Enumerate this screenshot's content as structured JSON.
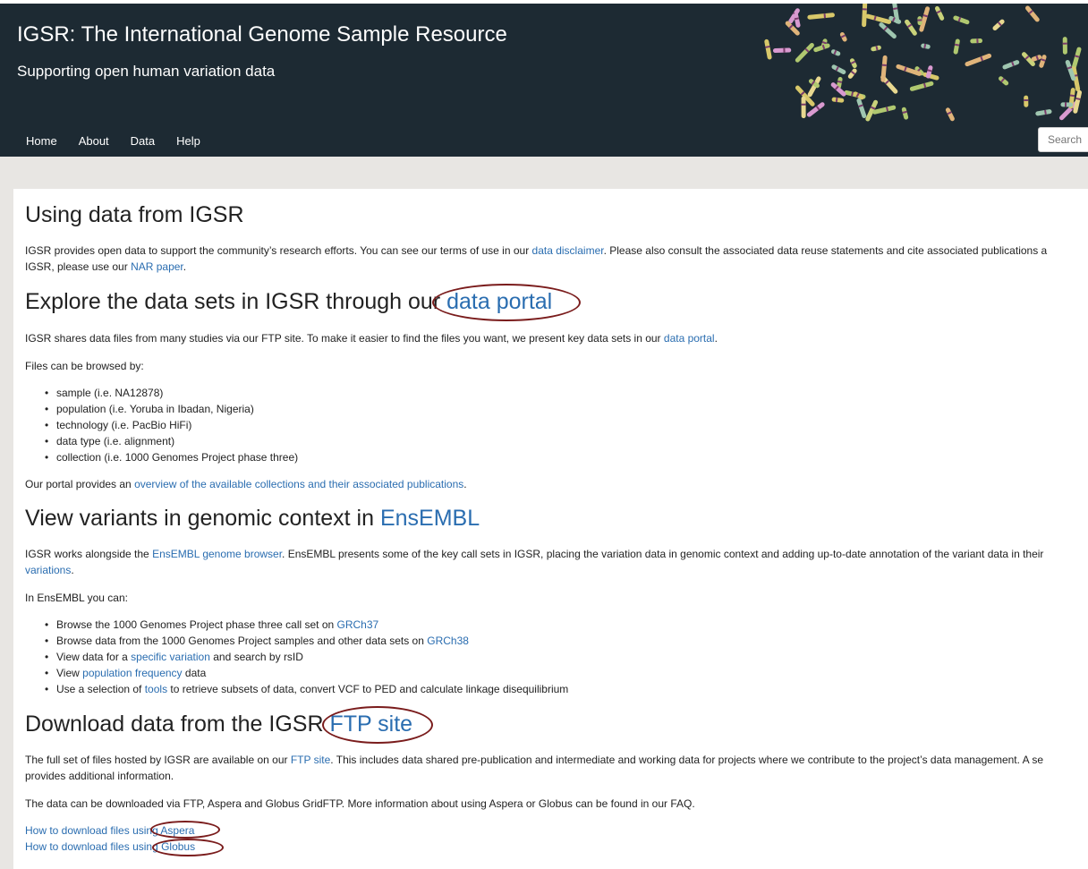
{
  "header": {
    "title": "IGSR: The International Genome Sample Resource",
    "subtitle": "Supporting open human variation data"
  },
  "nav": {
    "items": [
      "Home",
      "About",
      "Data",
      "Help"
    ],
    "search_placeholder": "Search"
  },
  "section_using": {
    "heading": "Using data from IGSR",
    "p1_a": "IGSR provides open data to support the community’s research efforts. You can see our terms of use in our ",
    "p1_link1": "data disclaimer",
    "p1_b": ". Please also consult the associated data reuse statements and cite associated publications a",
    "p1_line2_a": "IGSR, please use our ",
    "p1_link2": "NAR paper",
    "p1_line2_b": "."
  },
  "section_portal": {
    "heading_a": "Explore the data sets in IGSR through our ",
    "heading_link": "data portal",
    "p1_a": "IGSR shares data files from many studies via our FTP site. To make it easier to find the files you want, we present key data sets in our ",
    "p1_link": "data portal",
    "p1_b": ".",
    "p2": "Files can be browsed by:",
    "items": [
      "sample (i.e. NA12878)",
      "population (i.e. Yoruba in Ibadan, Nigeria)",
      "technology (i.e. PacBio HiFi)",
      "data type (i.e. alignment)",
      "collection (i.e. 1000 Genomes Project phase three)"
    ],
    "p3_a": "Our portal provides an ",
    "p3_link": "overview of the available collections and their associated publications",
    "p3_b": "."
  },
  "section_ensembl": {
    "heading_a": "View variants in genomic context in ",
    "heading_link": "EnsEMBL",
    "p1_a": "IGSR works alongside the ",
    "p1_link": "EnsEMBL genome browser",
    "p1_b": ". EnsEMBL presents some of the key call sets in IGSR, placing the variation data in genomic context and adding up-to-date annotation of the variant data in their",
    "p1_line2_link": "variations",
    "p1_line2_b": ".",
    "p2": "In EnsEMBL you can:",
    "items": [
      {
        "a": "Browse the 1000 Genomes Project phase three call set on ",
        "link": "GRCh37",
        "b": ""
      },
      {
        "a": "Browse data from the 1000 Genomes Project samples and other data sets on ",
        "link": "GRCh38",
        "b": ""
      },
      {
        "a": "View data for a ",
        "link": "specific variation",
        "b": " and search by rsID"
      },
      {
        "a": "View ",
        "link": "population frequency",
        "b": " data"
      },
      {
        "a": "Use a selection of ",
        "link": "tools",
        "b": " to retrieve subsets of data, convert VCF to PED and calculate linkage disequilibrium"
      }
    ]
  },
  "section_ftp": {
    "heading_a": "Download data from the IGSR ",
    "heading_link": "FTP site",
    "p1_a": "The full set of files hosted by IGSR are available on our ",
    "p1_link": "FTP site",
    "p1_b": ". This includes data shared pre-publication and intermediate and working data for projects where we contribute to the project’s data management. A se",
    "p1_line2": "provides additional information.",
    "p2": "The data can be downloaded via FTP, Aspera and Globus GridFTP. More information about using Aspera or Globus can be found in our FAQ.",
    "link_aspera": "How to download files using Aspera",
    "link_globus": "How to download files using Globus"
  },
  "colors": {
    "header_bg": "#1d2a33",
    "link": "#2a6db0",
    "annotation": "#7a1c1c"
  }
}
